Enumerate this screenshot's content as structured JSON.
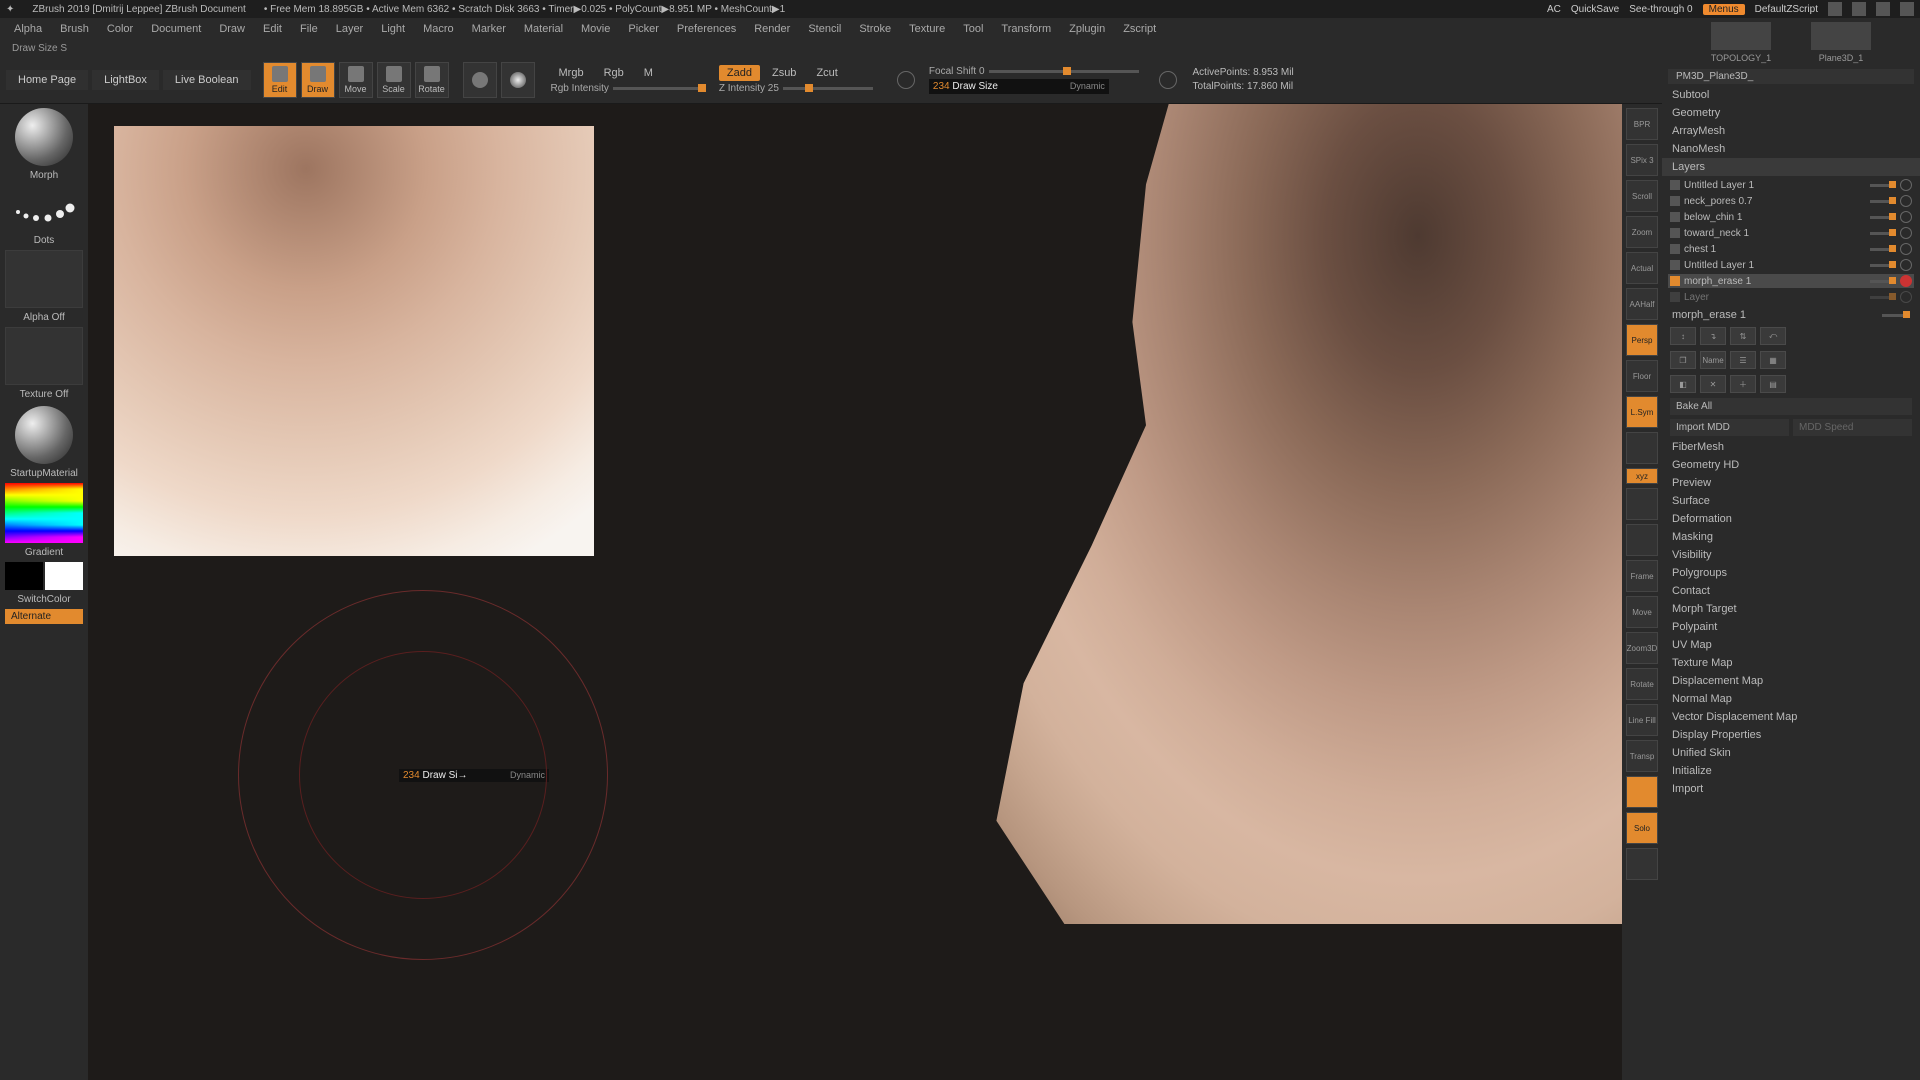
{
  "title": {
    "app": "ZBrush 2019 [Dmitrij Leppee]   ZBrush Document",
    "stats": "•  Free Mem 18.895GB  • Active Mem 6362  • Scratch Disk 3663  •  Timer▶0.025  • PolyCount▶8.951 MP  • MeshCount▶1",
    "ac": "AC",
    "quicksave": "QuickSave",
    "seethrough": "See-through  0",
    "menus": "Menus",
    "script": "DefaultZScript"
  },
  "menus": [
    "Alpha",
    "Brush",
    "Color",
    "Document",
    "Draw",
    "Edit",
    "File",
    "Layer",
    "Light",
    "Macro",
    "Marker",
    "Material",
    "Movie",
    "Picker",
    "Preferences",
    "Render",
    "Stencil",
    "Stroke",
    "Texture",
    "Tool",
    "Transform",
    "Zplugin",
    "Zscript"
  ],
  "infoline": "Draw Size S",
  "shelf": {
    "tabs": [
      "Home Page",
      "LightBox",
      "Live Boolean"
    ],
    "tools": [
      {
        "label": "Edit",
        "on": true
      },
      {
        "label": "Draw",
        "on": true
      },
      {
        "label": "Move",
        "on": false
      },
      {
        "label": "Scale",
        "on": false
      },
      {
        "label": "Rotate",
        "on": false
      }
    ],
    "modes": {
      "mrgb": "Mrgb",
      "rgb": "Rgb",
      "m": "M",
      "rgbint": "Rgb Intensity"
    },
    "zmodes": {
      "zadd": "Zadd",
      "zsub": "Zsub",
      "zcut": "Zcut",
      "zint": "Z Intensity 25"
    },
    "focal_shift": "Focal Shift 0",
    "draw_size_num": "234",
    "draw_size_label": "Draw Size",
    "draw_size_dyn": "Dynamic",
    "active_pts": "ActivePoints: 8.953 Mil",
    "total_pts": "TotalPoints: 17.860 Mil"
  },
  "left": {
    "brush": "Morph",
    "stroke": "Dots",
    "alpha": "Alpha Off",
    "texture": "Texture Off",
    "material": "StartupMaterial",
    "gradient": "Gradient",
    "switchcolor": "SwitchColor",
    "alternate": "Alternate"
  },
  "cursor": {
    "num": "234",
    "label": "Draw Si",
    "dyn": "Dynamic"
  },
  "rshelf": [
    "BPR",
    "SPix 3",
    "Scroll",
    "Zoom",
    "Actual",
    "AAHalf",
    "Persp",
    "Floor",
    "L.Sym",
    "",
    "xyz",
    "",
    "",
    "Frame",
    "Move",
    "Zoom3D",
    "Rotate",
    "Line Fill",
    "Transp",
    "",
    "Solo",
    ""
  ],
  "rshelf_on": {
    "6": true,
    "8": true,
    "10": true,
    "19": true,
    "20": true
  },
  "rightcol": {
    "thumbs": [
      "TOPOLOGY_1",
      "Plane3D_1"
    ],
    "toolname": "PM3D_Plane3D_",
    "sections1": [
      "Subtool",
      "Geometry",
      "ArrayMesh",
      "NanoMesh"
    ],
    "layers_hd": "Layers",
    "layers": [
      {
        "name": "Untitled Layer 1",
        "sel": false
      },
      {
        "name": "neck_pores 0.7",
        "sel": false
      },
      {
        "name": "below_chin 1",
        "sel": false
      },
      {
        "name": "toward_neck 1",
        "sel": false
      },
      {
        "name": "chest 1",
        "sel": false
      },
      {
        "name": "Untitled Layer 1",
        "sel": false
      },
      {
        "name": "morph_erase 1",
        "sel": true,
        "rec": true
      },
      {
        "name": "Layer",
        "sel": false,
        "dim": true
      }
    ],
    "current": "morph_erase 1",
    "name_btn": "Name",
    "bake": "Bake All",
    "import_mdd": "Import MDD",
    "mdd_speed": "MDD Speed",
    "sections2": [
      "FiberMesh",
      "Geometry HD",
      "Preview",
      "Surface",
      "Deformation",
      "Masking",
      "Visibility",
      "Polygroups",
      "Contact",
      "Morph Target",
      "Polypaint",
      "UV Map",
      "Texture Map",
      "Displacement Map",
      "Normal Map",
      "Vector Displacement Map",
      "Display Properties",
      "Unified Skin",
      "Initialize",
      "Import"
    ]
  }
}
